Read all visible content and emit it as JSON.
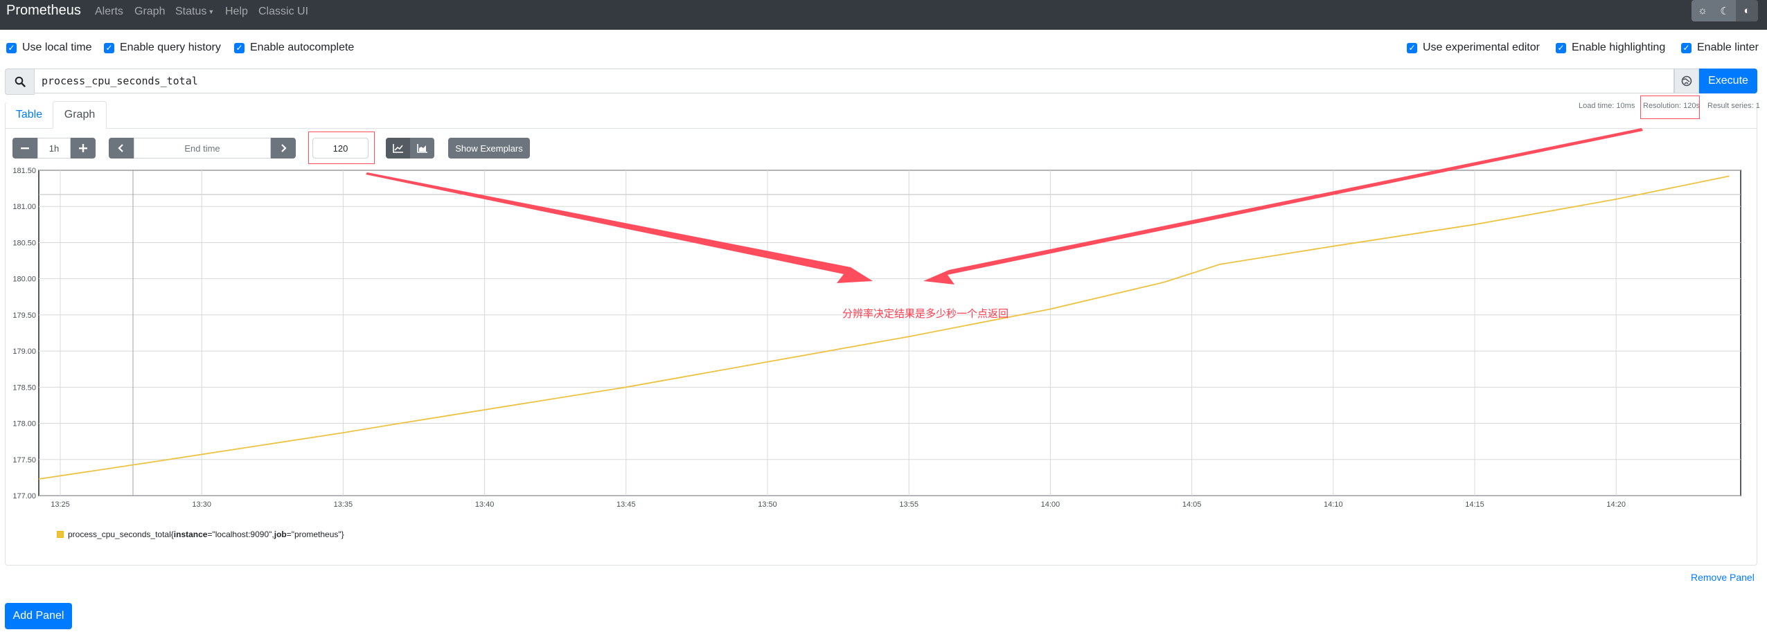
{
  "navbar": {
    "brand": "Prometheus",
    "items": [
      {
        "label": "Alerts"
      },
      {
        "label": "Graph"
      },
      {
        "label": "Status"
      },
      {
        "label": "Help"
      },
      {
        "label": "Classic UI"
      }
    ],
    "theme_icons": [
      "sun-icon",
      "moon-icon",
      "contrast-icon"
    ]
  },
  "options": {
    "left": [
      {
        "label": "Use local time",
        "checked": true
      },
      {
        "label": "Enable query history",
        "checked": true
      },
      {
        "label": "Enable autocomplete",
        "checked": true
      }
    ],
    "right": [
      {
        "label": "Use experimental editor",
        "checked": true
      },
      {
        "label": "Enable highlighting",
        "checked": true
      },
      {
        "label": "Enable linter",
        "checked": true
      }
    ]
  },
  "query": {
    "expression": "process_cpu_seconds_total",
    "execute_label": "Execute"
  },
  "tabs": [
    {
      "label": "Table",
      "active": false
    },
    {
      "label": "Graph",
      "active": true
    }
  ],
  "stats": {
    "load_time": "Load time: 10ms",
    "resolution": "Resolution: 120s",
    "result_series": "Result series: 1"
  },
  "controls": {
    "range": "1h",
    "end_time_placeholder": "End time",
    "resolution_value": "120",
    "exemplars_label": "Show Exemplars"
  },
  "chart_data": {
    "type": "line",
    "x_ticks": [
      "13:25",
      "13:30",
      "13:35",
      "13:40",
      "13:45",
      "13:50",
      "13:55",
      "14:00",
      "14:05",
      "14:10",
      "14:15",
      "14:20"
    ],
    "y_ticks": [
      "177.00",
      "177.50",
      "178.00",
      "178.50",
      "179.00",
      "179.50",
      "180.00",
      "180.50",
      "181.00",
      "181.50"
    ],
    "ylim": [
      177.0,
      181.5
    ],
    "series": [
      {
        "color": "#edc240",
        "x": [
          "13:24",
          "13:28",
          "13:35",
          "13:37",
          "13:45",
          "13:50",
          "13:55",
          "14:00",
          "14:04",
          "14:06",
          "14:10",
          "14:15",
          "14:20",
          "14:24"
        ],
        "values": [
          177.23,
          177.45,
          177.87,
          178.0,
          178.5,
          178.85,
          179.2,
          179.58,
          179.95,
          180.2,
          180.45,
          180.75,
          181.1,
          181.42
        ]
      }
    ]
  },
  "legend": {
    "metric": "process_cpu_seconds_total",
    "open": "{",
    "label1_key": "instance",
    "label1_val": "=\"localhost:9090\", ",
    "label2_key": "job",
    "label2_val": "=\"prometheus\"",
    "close": "}"
  },
  "annotation": {
    "text": "分辨率决定结果是多少秒一个点返回",
    "color": "#ff4d5e"
  },
  "footer": {
    "remove_panel": "Remove Panel",
    "add_panel": "Add Panel"
  },
  "colors": {
    "navbar": "#343a40",
    "primary": "#007bff",
    "secondary": "#6c757d",
    "series": "#edc240"
  }
}
